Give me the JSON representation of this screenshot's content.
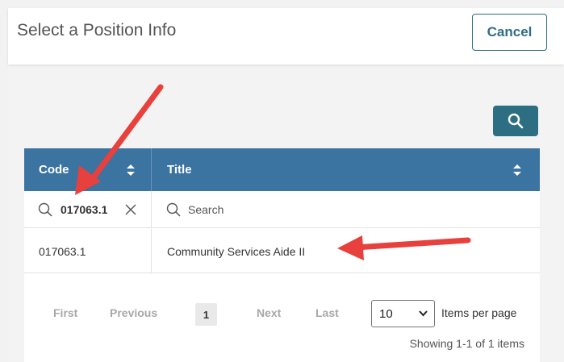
{
  "modal": {
    "title": "Select a Position Info",
    "cancel_label": "Cancel"
  },
  "toolbar": {
    "search_button_icon": "search-icon"
  },
  "grid": {
    "columns": [
      {
        "label": "Code",
        "icon": "sort-icon"
      },
      {
        "label": "Title",
        "icon": "sort-icon"
      }
    ],
    "filters": {
      "code_value": "017063.1",
      "title_placeholder": "Search"
    },
    "rows": [
      {
        "code": "017063.1",
        "title": "Community Services Aide II"
      }
    ]
  },
  "pager": {
    "first": "First",
    "previous": "Previous",
    "current_page": "1",
    "next": "Next",
    "last": "Last",
    "page_size": "10",
    "items_per_page_label": "Items per page",
    "showing": "Showing 1-1 of 1 items"
  },
  "colors": {
    "header_blue": "#3b73a1",
    "accent_teal": "#2d6e82",
    "annotation_red": "#e8403c"
  }
}
